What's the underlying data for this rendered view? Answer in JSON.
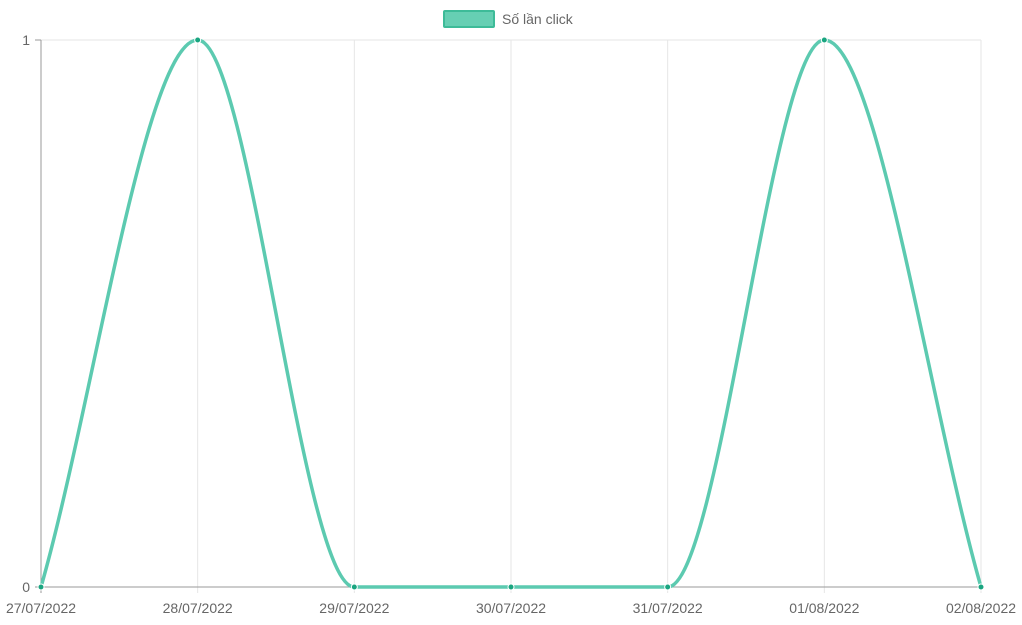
{
  "chart_data": {
    "type": "line",
    "categories": [
      "27/07/2022",
      "28/07/2022",
      "29/07/2022",
      "30/07/2022",
      "31/07/2022",
      "01/08/2022",
      "02/08/2022"
    ],
    "series": [
      {
        "name": "Số lần click",
        "values": [
          0,
          1,
          0,
          0,
          0,
          1,
          0
        ]
      }
    ],
    "y_ticks": [
      "0",
      "1"
    ],
    "ylim": [
      0,
      1
    ],
    "grid": true,
    "legend": "top-center",
    "colors": {
      "line": "#5ccab0",
      "point": "#1aa580",
      "legend_fill": "#66cfb3",
      "legend_border": "#3dbb98",
      "grid": "#e6e6e6",
      "axis": "#9a9a9a"
    }
  }
}
